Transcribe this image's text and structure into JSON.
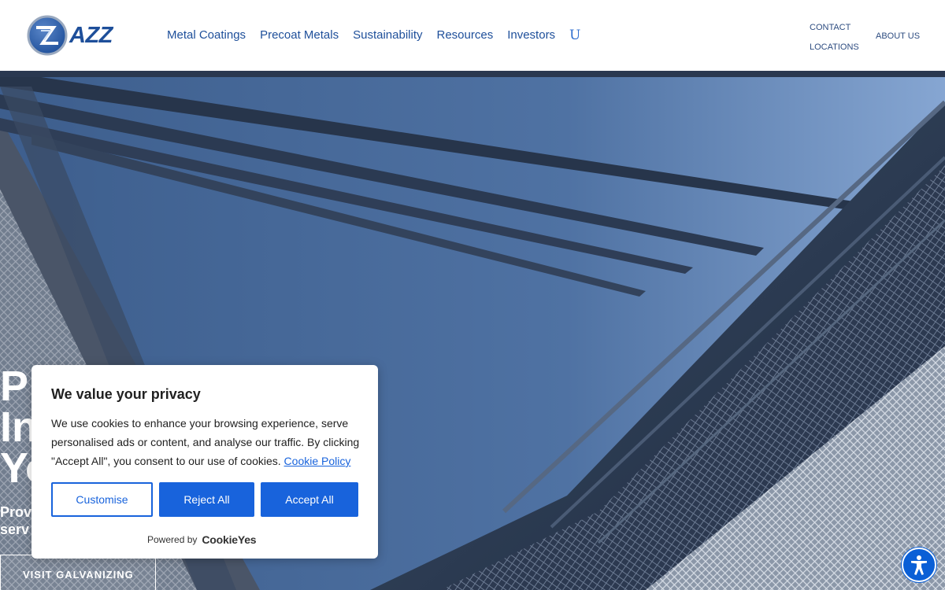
{
  "header": {
    "logo_text": "AZZ",
    "nav": [
      "Metal Coatings",
      "Precoat Metals",
      "Sustainability",
      "Resources",
      "Investors"
    ],
    "nav_extra": "U",
    "util": {
      "contact": "CONTACT",
      "locations": "LOCATIONS",
      "about": "ABOUT US"
    }
  },
  "hero": {
    "title": "P\nIn\nYo",
    "subtitle_line1": "Prov",
    "subtitle_line2": "serv",
    "button": "VISIT GALVANIZING"
  },
  "cookie": {
    "title": "We value your privacy",
    "body": "We use cookies to enhance your browsing experience, serve personalised ads or content, and analyse our traffic. By clicking \"Accept All\", you consent to our use of cookies.",
    "policy_link": "Cookie Policy",
    "customise": "Customise",
    "reject": "Reject All",
    "accept": "Accept All",
    "powered_by": "Powered by",
    "brand": "CookieYes"
  },
  "colors": {
    "brand_blue": "#1e4f9a",
    "cookie_blue": "#1863dc",
    "a11y_blue": "#0a5fd6"
  },
  "icons": {
    "logo": "azz-logo-icon",
    "accessibility": "accessibility-icon"
  }
}
